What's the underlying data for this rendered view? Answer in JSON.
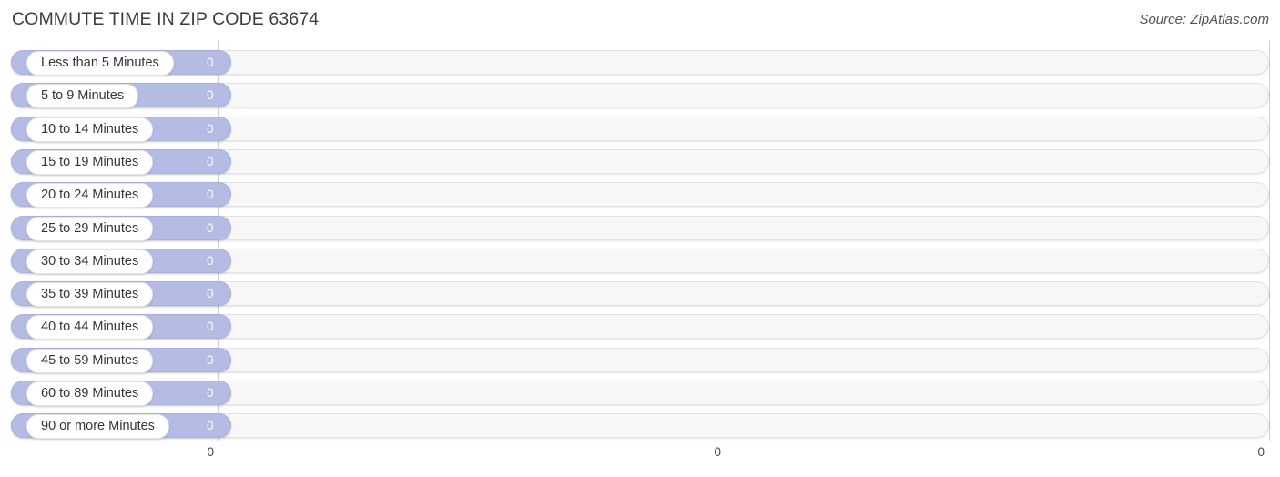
{
  "header": {
    "title": "COMMUTE TIME IN ZIP CODE 63674",
    "source": "Source: ZipAtlas.com"
  },
  "chart_data": {
    "type": "bar",
    "orientation": "horizontal",
    "title": "COMMUTE TIME IN ZIP CODE 63674",
    "subtitle": "Source: ZipAtlas.com",
    "xlabel": "",
    "ylabel": "",
    "xlim": [
      0,
      0
    ],
    "grid": true,
    "legend": null,
    "categories": [
      "Less than 5 Minutes",
      "5 to 9 Minutes",
      "10 to 14 Minutes",
      "15 to 19 Minutes",
      "20 to 24 Minutes",
      "25 to 29 Minutes",
      "30 to 34 Minutes",
      "35 to 39 Minutes",
      "40 to 44 Minutes",
      "45 to 59 Minutes",
      "60 to 89 Minutes",
      "90 or more Minutes"
    ],
    "values": [
      0,
      0,
      0,
      0,
      0,
      0,
      0,
      0,
      0,
      0,
      0,
      0
    ],
    "value_labels": [
      "0",
      "0",
      "0",
      "0",
      "0",
      "0",
      "0",
      "0",
      "0",
      "0",
      "0",
      "0"
    ],
    "xticks": [
      "0",
      "0",
      "0"
    ],
    "colors": {
      "bar": "#b4bce4",
      "bar_border": "#a7b0de",
      "track": "#f7f7f7",
      "track_border": "#e2e2e2",
      "label_pill": "#ffffff",
      "value_text": "#ffffff",
      "gridline": "#d0d0d0",
      "title_text": "#3c3c46"
    }
  }
}
